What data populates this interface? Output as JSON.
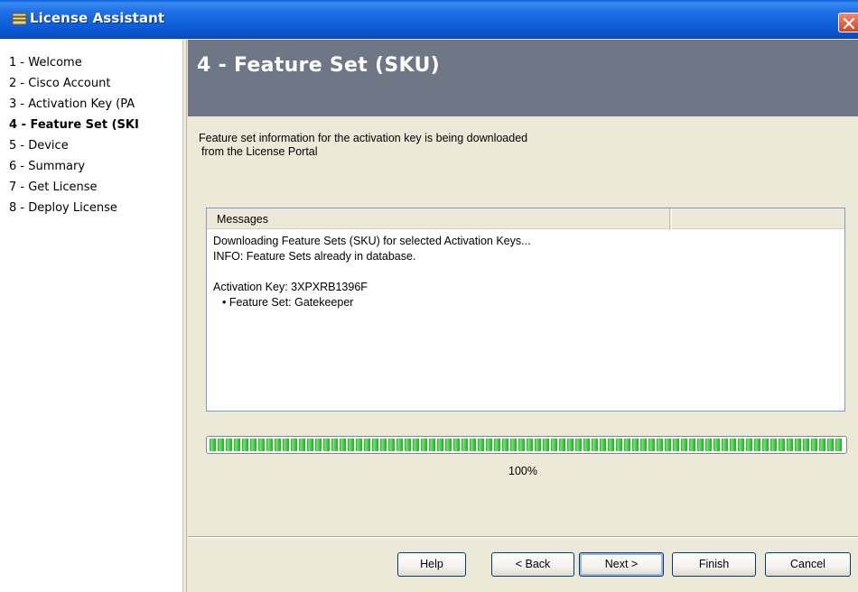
{
  "window": {
    "title": "License Assistant",
    "icons": {
      "app": "license-assistant-app-icon",
      "close": "close-icon"
    }
  },
  "sidebar": {
    "items": [
      {
        "label": "1 - Welcome",
        "active": false
      },
      {
        "label": "2 - Cisco Account",
        "active": false
      },
      {
        "label": "3 - Activation Key (PA",
        "active": false
      },
      {
        "label": "4 - Feature Set (SKI",
        "active": true
      },
      {
        "label": "5 - Device",
        "active": false
      },
      {
        "label": "6 - Summary",
        "active": false
      },
      {
        "label": "7 - Get License",
        "active": false
      },
      {
        "label": "8 - Deploy License",
        "active": false
      }
    ]
  },
  "main": {
    "header_title": "4 - Feature Set (SKU)",
    "description_line1": "Feature set information for the activation key is being downloaded",
    "description_line2": "from the License Portal",
    "messages": {
      "column_header": "Messages",
      "lines": [
        "Downloading Feature Sets (SKU) for selected Activation Keys...",
        "INFO: Feature Sets already in database.",
        "",
        "Activation Key: 3XPXRB1396F",
        "• Feature Set: Gatekeeper"
      ]
    },
    "progress": {
      "value": 100,
      "label": "100%"
    }
  },
  "footer": {
    "help_label": "Help",
    "back_label": "< Back",
    "next_label": "Next >",
    "finish_label": "Finish",
    "cancel_label": "Cancel"
  },
  "colors": {
    "titlebar": "#0d5dd8",
    "header_band": "#6f7787",
    "progress": "#2ea72e",
    "window_bg": "#ece9d8"
  }
}
